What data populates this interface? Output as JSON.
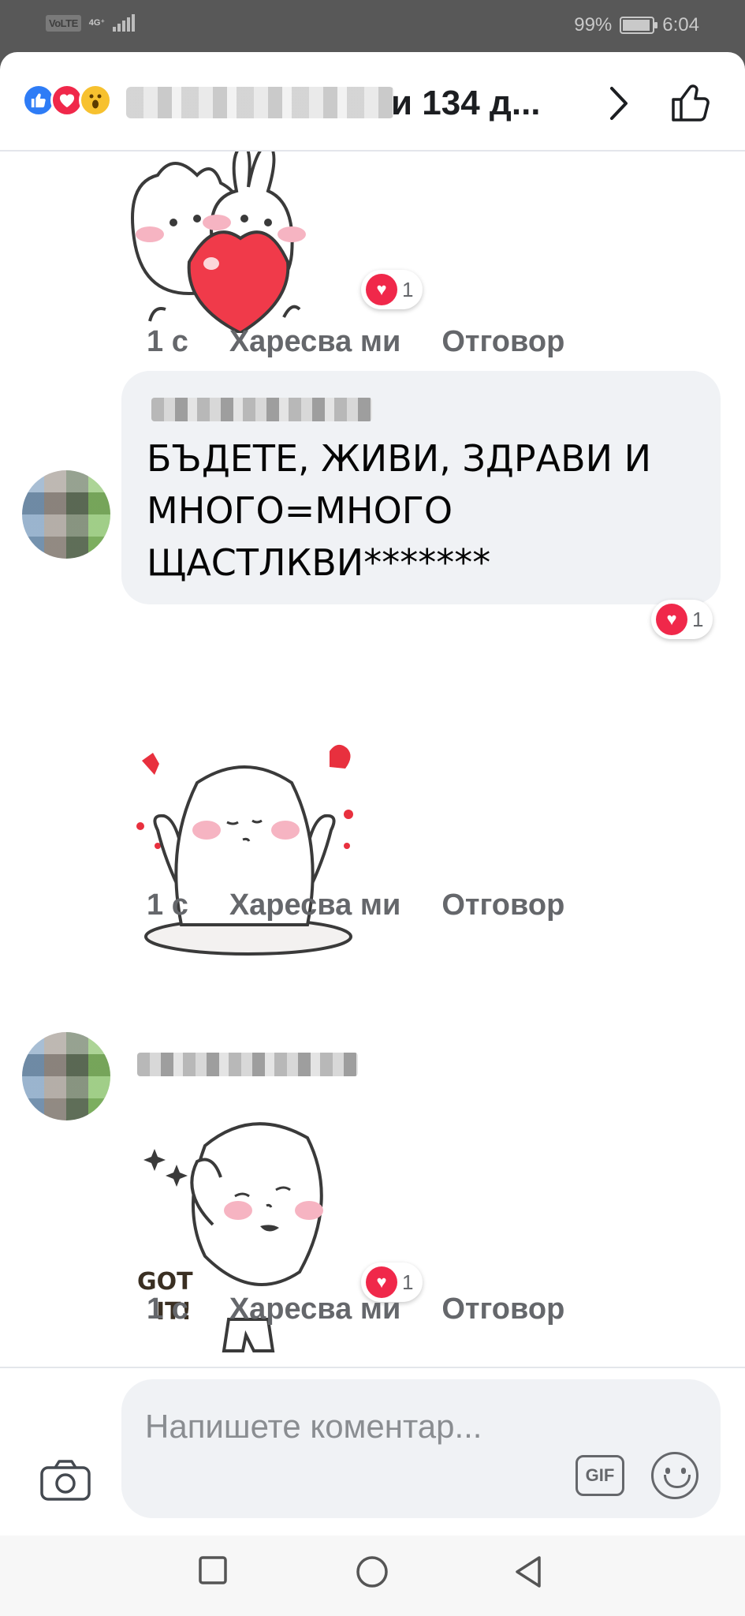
{
  "status_bar": {
    "carrier_badge": "VoLTE",
    "network": "4G⁺",
    "battery": "99%",
    "time": "6:04"
  },
  "header": {
    "reactions": [
      "like-icon",
      "love-icon",
      "wow-icon"
    ],
    "title": "и 134 д..."
  },
  "comments": [
    {
      "sticker": "cat-and-bunny-hugging-heart-sticker",
      "reaction_count": "1",
      "time": "1 с",
      "like_label": "Харесва ми",
      "reply_label": "Отговор"
    },
    {
      "text": "БЪДЕТЕ, ЖИВИ, ЗДРАВИ И МНОГО=МНОГО ЩАСТЛКВИ*******",
      "text_reaction_count": "1",
      "sticker": "round-character-with-hearts-sticker",
      "time": "1 с",
      "like_label": "Харесва ми",
      "reply_label": "Отговор"
    },
    {
      "sticker": "round-character-got-it-sticker",
      "sticker_text": "GOT IT!",
      "reaction_count": "1",
      "time": "1 с",
      "like_label": "Харесва ми",
      "reply_label": "Отговор"
    }
  ],
  "composer": {
    "placeholder": "Напишете коментар...",
    "gif_label": "GIF"
  },
  "colors": {
    "like_blue": "#2e7cf6",
    "love_red": "#f0284a",
    "meta_gray": "#65676b",
    "bubble_bg": "#f0f2f5"
  }
}
